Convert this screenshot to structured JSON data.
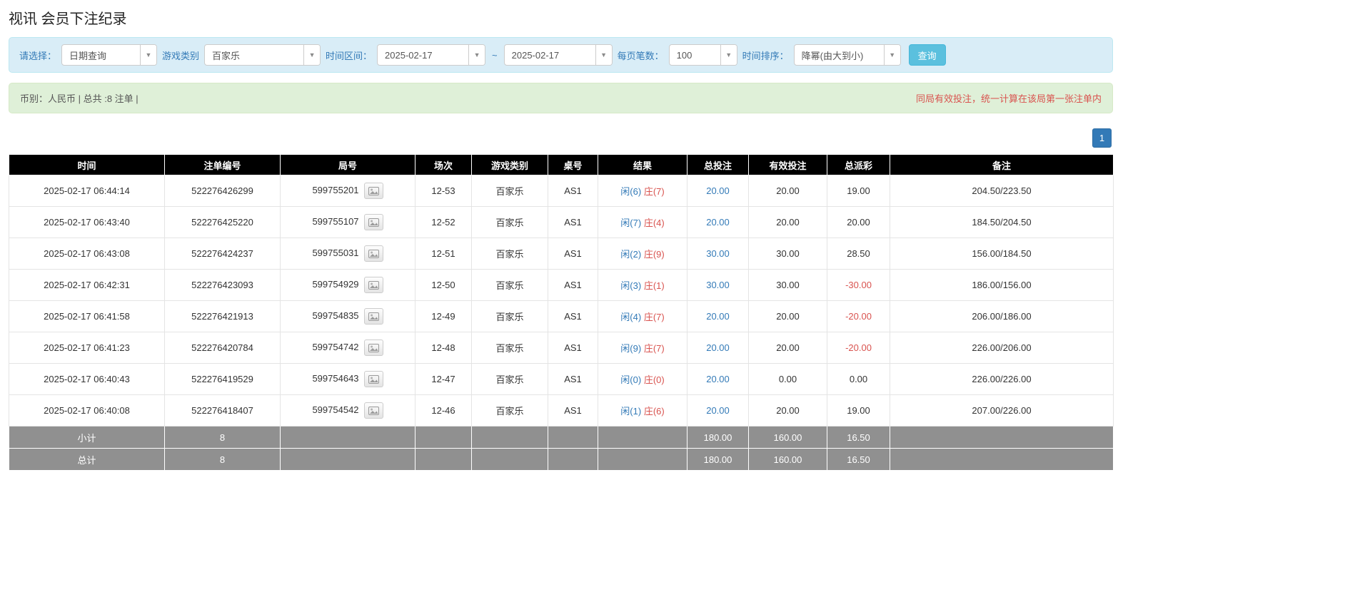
{
  "page": {
    "title": "视讯 会员下注纪录"
  },
  "colors": {
    "header_bg": "#000000",
    "accent_blue": "#337ab7",
    "red": "#d9534f",
    "filter_bar_bg": "#d9edf7",
    "summary_bar_bg": "#dff0d8",
    "search_button_bg": "#5bc0de",
    "footer_row_bg": "#909090"
  },
  "filters": {
    "select_label": "请选择：",
    "select_value": "日期查询",
    "game_type_label": "游戏类别",
    "game_type_value": "百家乐",
    "time_range_label": "时间区间：",
    "date_from": "2025-02-17",
    "tilde": "~",
    "date_to": "2025-02-17",
    "page_size_label": "每页笔数：",
    "page_size_value": "100",
    "sort_label": "时间排序：",
    "sort_value": "降幂(由大到小)",
    "search_button": "查询"
  },
  "summary": {
    "left": "币别：人民币 | 总共 :8 注单 |",
    "right": "同局有效投注，统一计算在该局第一张注单内"
  },
  "pagination": {
    "current": "1"
  },
  "table": {
    "headers": [
      "时间",
      "注单编号",
      "局号",
      "场次",
      "游戏类别",
      "桌号",
      "结果",
      "总投注",
      "有效投注",
      "总派彩",
      "备注"
    ],
    "rows": [
      {
        "time": "2025-02-17 06:44:14",
        "bet_id": "522276426299",
        "round_id": "599755201",
        "session": "12-53",
        "game": "百家乐",
        "table_no": "AS1",
        "result_player": "闲(6)",
        "result_banker": "庄(7)",
        "total_bet": "20.00",
        "valid_bet": "20.00",
        "payout": "19.00",
        "remark": "204.50/223.50"
      },
      {
        "time": "2025-02-17 06:43:40",
        "bet_id": "522276425220",
        "round_id": "599755107",
        "session": "12-52",
        "game": "百家乐",
        "table_no": "AS1",
        "result_player": "闲(7)",
        "result_banker": "庄(4)",
        "total_bet": "20.00",
        "valid_bet": "20.00",
        "payout": "20.00",
        "remark": "184.50/204.50"
      },
      {
        "time": "2025-02-17 06:43:08",
        "bet_id": "522276424237",
        "round_id": "599755031",
        "session": "12-51",
        "game": "百家乐",
        "table_no": "AS1",
        "result_player": "闲(2)",
        "result_banker": "庄(9)",
        "total_bet": "30.00",
        "valid_bet": "30.00",
        "payout": "28.50",
        "remark": "156.00/184.50"
      },
      {
        "time": "2025-02-17 06:42:31",
        "bet_id": "522276423093",
        "round_id": "599754929",
        "session": "12-50",
        "game": "百家乐",
        "table_no": "AS1",
        "result_player": "闲(3)",
        "result_banker": "庄(1)",
        "total_bet": "30.00",
        "valid_bet": "30.00",
        "payout": "-30.00",
        "remark": "186.00/156.00"
      },
      {
        "time": "2025-02-17 06:41:58",
        "bet_id": "522276421913",
        "round_id": "599754835",
        "session": "12-49",
        "game": "百家乐",
        "table_no": "AS1",
        "result_player": "闲(4)",
        "result_banker": "庄(7)",
        "total_bet": "20.00",
        "valid_bet": "20.00",
        "payout": "-20.00",
        "remark": "206.00/186.00"
      },
      {
        "time": "2025-02-17 06:41:23",
        "bet_id": "522276420784",
        "round_id": "599754742",
        "session": "12-48",
        "game": "百家乐",
        "table_no": "AS1",
        "result_player": "闲(9)",
        "result_banker": "庄(7)",
        "total_bet": "20.00",
        "valid_bet": "20.00",
        "payout": "-20.00",
        "remark": "226.00/206.00"
      },
      {
        "time": "2025-02-17 06:40:43",
        "bet_id": "522276419529",
        "round_id": "599754643",
        "session": "12-47",
        "game": "百家乐",
        "table_no": "AS1",
        "result_player": "闲(0)",
        "result_banker": "庄(0)",
        "total_bet": "20.00",
        "valid_bet": "0.00",
        "payout": "0.00",
        "remark": "226.00/226.00"
      },
      {
        "time": "2025-02-17 06:40:08",
        "bet_id": "522276418407",
        "round_id": "599754542",
        "session": "12-46",
        "game": "百家乐",
        "table_no": "AS1",
        "result_player": "闲(1)",
        "result_banker": "庄(6)",
        "total_bet": "20.00",
        "valid_bet": "20.00",
        "payout": "19.00",
        "remark": "207.00/226.00"
      }
    ],
    "subtotal": {
      "label": "小计",
      "count": "8",
      "total_bet": "180.00",
      "valid_bet": "160.00",
      "payout": "16.50"
    },
    "total": {
      "label": "总计",
      "count": "8",
      "total_bet": "180.00",
      "valid_bet": "160.00",
      "payout": "16.50"
    }
  }
}
